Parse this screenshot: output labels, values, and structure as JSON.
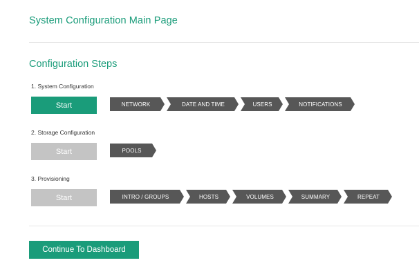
{
  "header": {
    "title": "System Configuration Main Page"
  },
  "steps_section": {
    "title": "Configuration Steps",
    "steps": [
      {
        "label": "1. System Configuration",
        "start_label": "Start",
        "start_enabled": true,
        "substeps": [
          "NETWORK",
          "DATE AND TIME",
          "USERS",
          "NOTIFICATIONS"
        ]
      },
      {
        "label": "2. Storage Configuration",
        "start_label": "Start",
        "start_enabled": false,
        "substeps": [
          "POOLS"
        ]
      },
      {
        "label": "3. Provisioning",
        "start_label": "Start",
        "start_enabled": false,
        "substeps": [
          "INTRO / GROUPS",
          "HOSTS",
          "VOLUMES",
          "SUMMARY",
          "REPEAT"
        ]
      }
    ]
  },
  "footer": {
    "continue_label": "Continue To Dashboard"
  },
  "colors": {
    "accent": "#1a9c7a",
    "chevron": "#575757",
    "disabled": "#c4c4c4"
  }
}
